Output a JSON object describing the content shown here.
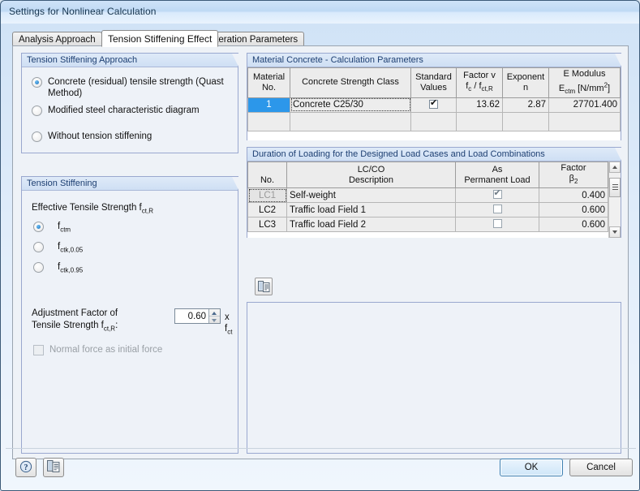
{
  "window": {
    "title": "Settings for Nonlinear Calculation"
  },
  "tabs": [
    {
      "label": "Analysis Approach",
      "active": false
    },
    {
      "label": "Tension Stiffening Effect",
      "active": true
    },
    {
      "label": "Iteration Parameters",
      "active": false
    }
  ],
  "approach_group": {
    "title": "Tension Stiffening Approach",
    "options": [
      {
        "label": "Concrete (residual) tensile strength (Quast Method)",
        "selected": true
      },
      {
        "label": "Modified steel characteristic diagram",
        "selected": false
      },
      {
        "label": "Without tension stiffening",
        "selected": false
      }
    ]
  },
  "tension_stiffening_group": {
    "title": "Tension Stiffening",
    "effective_label": "Effective Tensile Strength f",
    "effective_sub": "ct,R",
    "options": [
      {
        "base": "f",
        "sub": "ctm",
        "selected": true
      },
      {
        "base": "f",
        "sub": "ctk,0.05",
        "selected": false
      },
      {
        "base": "f",
        "sub": "ctk,0.95",
        "selected": false
      }
    ],
    "adjustment_label_line1": "Adjustment Factor of",
    "adjustment_label_line2": "Tensile Strength  f",
    "adjustment_label_sub": "ct,R",
    "adjustment_label_colon": ":",
    "adjustment_value": "0.60",
    "adjustment_unit_base": "x f",
    "adjustment_unit_sub": "ct",
    "normal_force_label": "Normal force as initial force",
    "normal_force_checked": false,
    "normal_force_disabled": true
  },
  "material_group": {
    "title": "Material Concrete - Calculation Parameters",
    "columns": [
      {
        "line1": "Material",
        "line2": "No."
      },
      {
        "line1": "",
        "line2": "Concrete Strength Class"
      },
      {
        "line1": "Standard",
        "line2": "Values"
      },
      {
        "line1": "Factor v",
        "line2": "f c / f ct,R"
      },
      {
        "line1": "Exponent",
        "line2": "n"
      },
      {
        "line1": "E Modulus",
        "line2": "E ctm [N/mm 2]"
      }
    ],
    "rows": [
      {
        "no": "1",
        "strength_class": "Concrete C25/30",
        "standard_values": true,
        "factor_v": "13.62",
        "exponent_n": "2.87",
        "e_modulus": "27701.400"
      }
    ]
  },
  "duration_group": {
    "title": "Duration of Loading for the Designed Load Cases and Load Combinations",
    "columns": [
      {
        "line1": "",
        "line2": "No."
      },
      {
        "line1": "LC/CO",
        "line2": "Description"
      },
      {
        "line1": "As",
        "line2": "Permanent Load"
      },
      {
        "line1": "Factor",
        "line2": "β2"
      }
    ],
    "rows": [
      {
        "no": "LC1",
        "description": "Self-weight",
        "permanent": true,
        "factor": "0.400",
        "focused": true
      },
      {
        "no": "LC2",
        "description": "Traffic load Field 1",
        "permanent": false,
        "factor": "0.600",
        "focused": false
      },
      {
        "no": "LC3",
        "description": "Traffic load Field 2",
        "permanent": false,
        "factor": "0.600",
        "focused": false
      }
    ]
  },
  "buttons": {
    "ok": "OK",
    "cancel": "Cancel"
  },
  "icons": {
    "help": "help-question-icon",
    "document": "document-list-icon",
    "table_tool": "document-list-icon"
  }
}
